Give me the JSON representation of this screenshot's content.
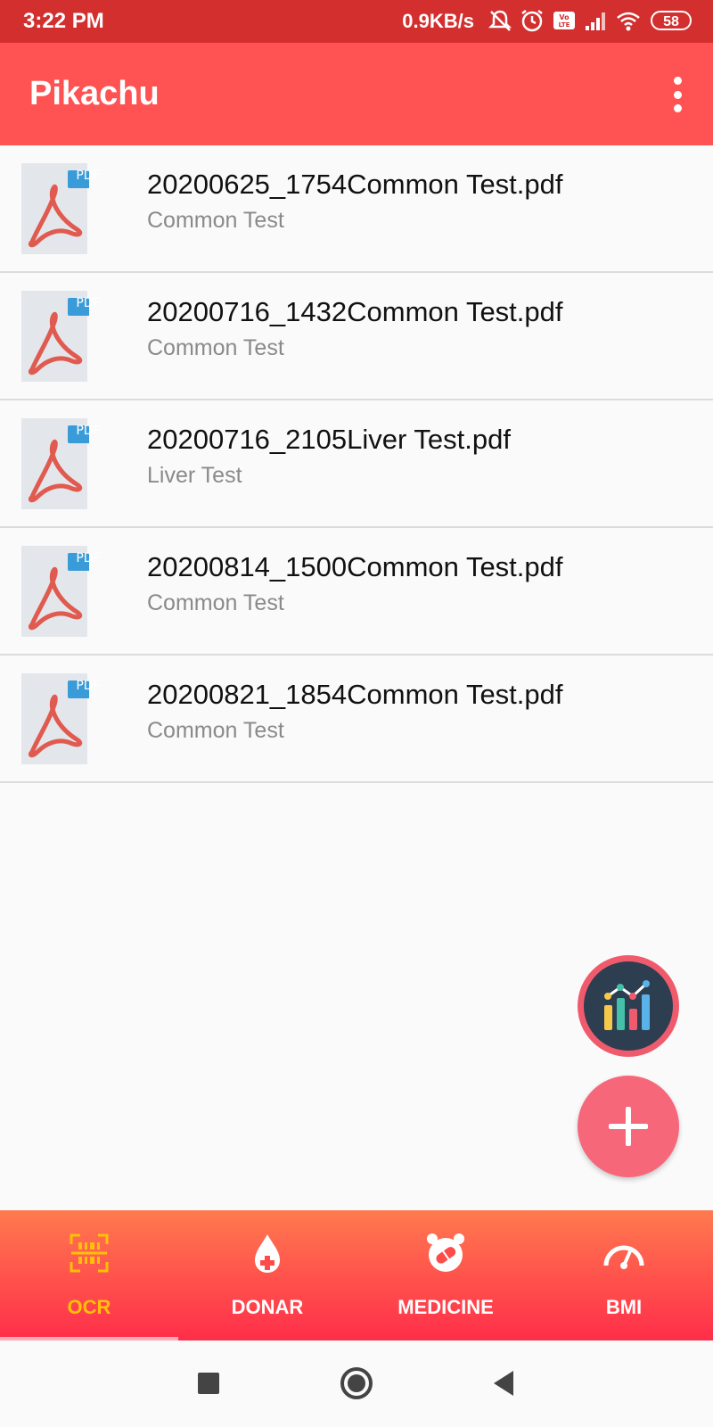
{
  "status_bar": {
    "time": "3:22 PM",
    "network_speed": "0.9KB/s",
    "battery": "58",
    "icons": [
      "mute-icon",
      "alarm-icon",
      "volte-icon",
      "signal-icon",
      "wifi-icon",
      "battery-icon"
    ]
  },
  "app_bar": {
    "title": "Pikachu",
    "menu_icon": "overflow-menu-icon"
  },
  "files": [
    {
      "name": "20200625_1754Common Test.pdf",
      "subtitle": "Common Test",
      "badge": "PDF"
    },
    {
      "name": "20200716_1432Common Test.pdf",
      "subtitle": "Common Test",
      "badge": "PDF"
    },
    {
      "name": "20200716_2105Liver Test.pdf",
      "subtitle": "Liver Test",
      "badge": "PDF"
    },
    {
      "name": "20200814_1500Common Test.pdf",
      "subtitle": "Common Test",
      "badge": "PDF"
    },
    {
      "name": "20200821_1854Common Test.pdf",
      "subtitle": "Common Test",
      "badge": "PDF"
    }
  ],
  "fabs": {
    "chart_icon": "chart-icon",
    "add_icon": "add-icon"
  },
  "bottom_nav": {
    "items": [
      {
        "label": "OCR",
        "icon": "scan-icon",
        "active": true
      },
      {
        "label": "DONAR",
        "icon": "blood-drop-icon",
        "active": false
      },
      {
        "label": "MEDICINE",
        "icon": "pill-alarm-icon",
        "active": false
      },
      {
        "label": "BMI",
        "icon": "gauge-icon",
        "active": false
      }
    ]
  },
  "colors": {
    "status_bar": "#d32f2f",
    "app_bar": "#ff5252",
    "fab_add": "#f7677a",
    "nav_active": "#ffc107",
    "pdf_red": "#e05a4f",
    "pdf_badge": "#3a9bd9"
  },
  "system_nav": {
    "icons": [
      "recent-apps-icon",
      "home-icon",
      "back-icon"
    ]
  }
}
